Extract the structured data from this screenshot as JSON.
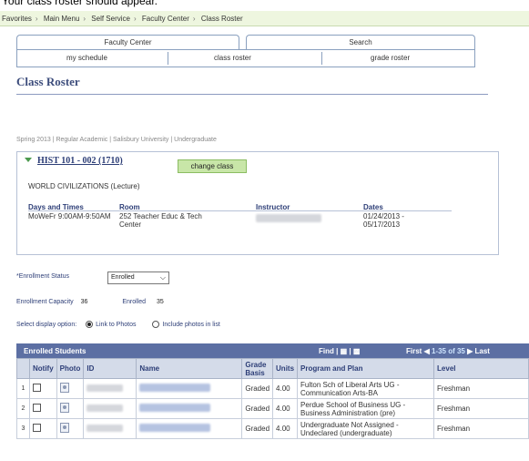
{
  "caption": "Your class roster should appear.",
  "breadcrumb": [
    "Favorites",
    "Main Menu",
    "Self Service",
    "Faculty Center",
    "Class Roster"
  ],
  "tabs": {
    "main": [
      "Faculty Center",
      "Search"
    ],
    "sub": [
      "my schedule",
      "class roster",
      "grade roster"
    ]
  },
  "page_title": "Class Roster",
  "term_line": "Spring 2013 | Regular Academic | Salisbury University | Undergraduate",
  "course": {
    "title": "HIST 101 - 002 (1710)",
    "change_label": "change class",
    "description": "WORLD CIVILIZATIONS (Lecture)",
    "headers": [
      "Days and Times",
      "Room",
      "Instructor",
      "Dates"
    ],
    "days_times": "MoWeFr 9:00AM-9:50AM",
    "room": "252 Teacher Educ & Tech Center",
    "dates": "01/24/2013 - 05/17/2013"
  },
  "enrollment": {
    "status_label": "*Enrollment Status",
    "status_value": "Enrolled",
    "capacity_label": "Enrollment Capacity",
    "capacity": "36",
    "enrolled_label": "Enrolled",
    "enrolled": "35"
  },
  "display": {
    "label": "Select display option:",
    "opt1": "Link to Photos",
    "opt2": "Include photos in list",
    "selected": "Link to Photos"
  },
  "grid": {
    "title": "Enrolled Students",
    "find": "Find |",
    "first": "First",
    "range": "1-35 of 35",
    "last": "Last",
    "columns": [
      "",
      "Notify",
      "Photo",
      "ID",
      "Name",
      "Grade Basis",
      "Units",
      "Program and Plan",
      "Level"
    ],
    "rows": [
      {
        "n": "1",
        "basis": "Graded",
        "units": "4.00",
        "plan": "Fulton Sch of Liberal Arts UG - Communication Arts-BA",
        "level": "Freshman"
      },
      {
        "n": "2",
        "basis": "Graded",
        "units": "4.00",
        "plan": "Perdue School of Business UG - Business Administration (pre)",
        "level": "Freshman"
      },
      {
        "n": "3",
        "basis": "Graded",
        "units": "4.00",
        "plan": "Undergraduate Not Assigned - Undeclared (undergraduate)",
        "level": "Freshman"
      }
    ]
  },
  "colors": {
    "grid_header": "#5c6fa3",
    "title": "#3d4d7c",
    "change_btn": "#c8e6a8"
  }
}
